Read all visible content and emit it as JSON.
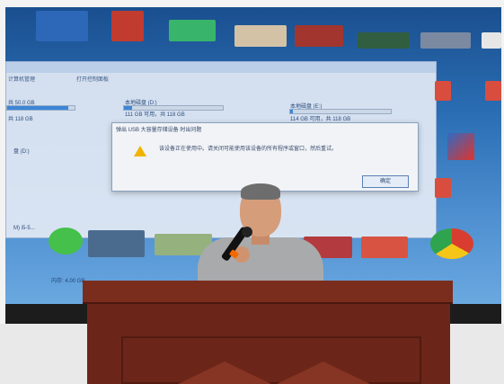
{
  "scene": {
    "description_items": {
      "screen_title_bar_left": "计算机管理",
      "screen_title_bar_middle": "打开控制面板",
      "drive_d_label": "本地磁盘 (D:)",
      "drive_d_usage": "111 GB 可用，共 118 GB",
      "drive_e_label": "本地磁盘 (E:)",
      "drive_e_usage": "114 GB 可用，共 118 GB",
      "left_drive_usage": "共 50.0 GB",
      "left_small_usage": "共 118 GB",
      "dialog_title": "弹出 USB 大容量存储设备 时出问题",
      "dialog_message": "该设备正在使用中。请关闭可能使用该设备的所有程序或窗口，然后重试。",
      "dialog_button": "确定",
      "memory_text": "内存: 4.00 GB",
      "side_item_1": "盘 (D:)",
      "side_item_2": "M) i5-5..."
    }
  }
}
